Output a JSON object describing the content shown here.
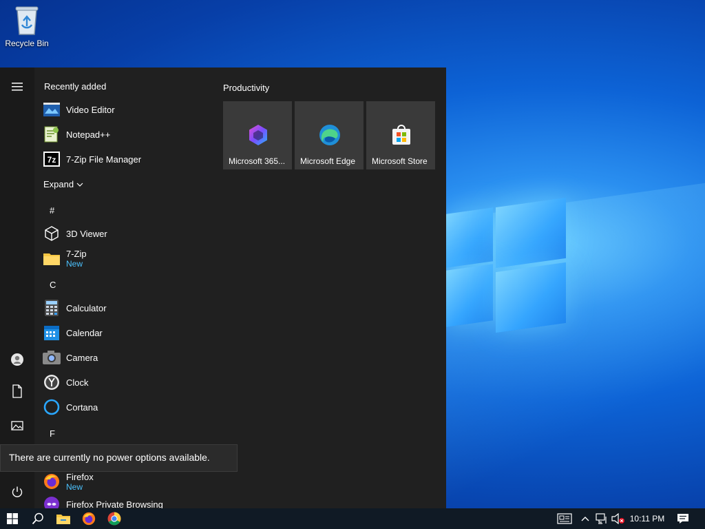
{
  "desktop": {
    "icons": [
      {
        "label": "Recycle Bin",
        "icon": "recycle-bin-icon"
      }
    ]
  },
  "start_menu": {
    "recently_added_header": "Recently added",
    "recently_added": [
      {
        "name": "Video Editor",
        "icon": "video-editor-icon"
      },
      {
        "name": "Notepad++",
        "icon": "notepadpp-icon"
      },
      {
        "name": "7-Zip File Manager",
        "icon": "7zip-icon"
      }
    ],
    "expand_label": "Expand",
    "groups": [
      {
        "letter": "#",
        "apps": [
          {
            "name": "3D Viewer",
            "sub": "",
            "icon": "3d-viewer-icon"
          },
          {
            "name": "7-Zip",
            "sub": "New",
            "icon": "folder-icon"
          }
        ]
      },
      {
        "letter": "C",
        "apps": [
          {
            "name": "Calculator",
            "sub": "",
            "icon": "calculator-icon"
          },
          {
            "name": "Calendar",
            "sub": "",
            "icon": "calendar-icon"
          },
          {
            "name": "Camera",
            "sub": "",
            "icon": "camera-icon"
          },
          {
            "name": "Clock",
            "sub": "",
            "icon": "clock-icon"
          },
          {
            "name": "Cortana",
            "sub": "",
            "icon": "cortana-icon"
          }
        ]
      },
      {
        "letter": "F",
        "apps": [
          {
            "name": "Firefox",
            "sub": "New",
            "icon": "firefox-icon"
          },
          {
            "name": "Firefox Private Browsing",
            "sub": "",
            "icon": "firefox-private-icon"
          }
        ]
      }
    ],
    "tiles_group_title": "Productivity",
    "tiles": [
      {
        "label": "Microsoft 365...",
        "icon": "microsoft-365-icon"
      },
      {
        "label": "Microsoft Edge",
        "icon": "edge-icon"
      },
      {
        "label": "Microsoft Store",
        "icon": "store-icon"
      }
    ],
    "power_tooltip": "There are currently no power options available."
  },
  "taskbar": {
    "clock": "10:11 PM",
    "pinned": [
      "windows-start-icon",
      "search-icon",
      "file-explorer-icon",
      "firefox-icon",
      "chrome-icon"
    ],
    "tray": [
      "news-icon",
      "chevron-up-icon",
      "network-icon",
      "volume-muted-icon",
      "notification-icon"
    ]
  },
  "colors": {
    "start_bg": "#202020",
    "tile_bg": "#3a3a3a",
    "accent_new": "#4cc2ff",
    "taskbar_bg": "#101a25"
  }
}
